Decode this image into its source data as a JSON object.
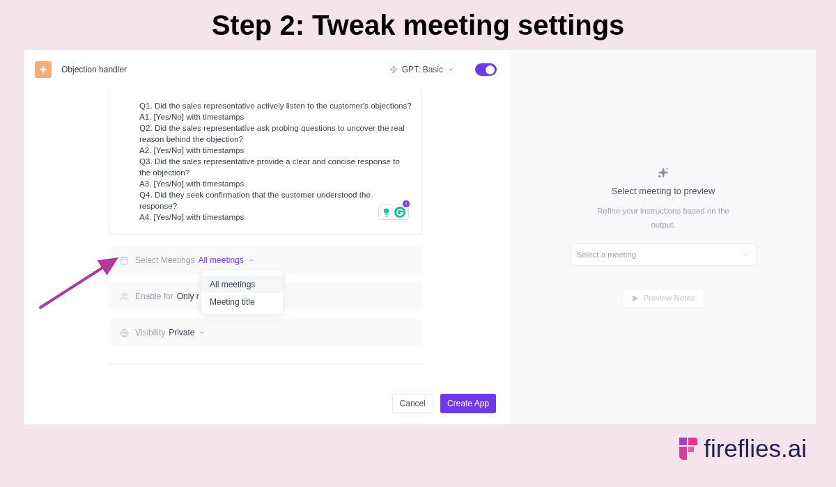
{
  "heading": "Step 2: Tweak meeting settings",
  "app_form": {
    "header": {
      "app_name": "Objection handler",
      "model": "GPT: Basic",
      "enabled": {
        "on": true
      }
    },
    "instruction_lines": [
      "Q1. Did the sales representative actively listen to the customer's objections?",
      "A1. [Yes/No] with timestamps",
      "Q2. Did the sales representative ask probing questions to uncover the real",
      "reason behind the objection?",
      "A2. [Yes/No] with timestamps",
      "Q3. Did the sales representative provide a clear and concise response to",
      "the objection?",
      "A3. [Yes/No] with timestamps",
      "Q4. Did they seek confirmation that the customer understood the",
      "response?",
      "A4. [Yes/No] with timestamps"
    ],
    "writing_assistant": {
      "count": "1"
    },
    "settings": [
      {
        "label": "Select Meetings",
        "value": "All meetings",
        "expanded": true,
        "options": [
          {
            "label": "All meetings",
            "selected": true
          },
          {
            "label": "Meeting title",
            "selected": false
          }
        ]
      },
      {
        "label": "Enable for",
        "value": "Only r"
      },
      {
        "label": "Visibility",
        "value": "Private",
        "expanded": false
      }
    ],
    "buttons": [
      {
        "label": "Cancel",
        "kind": "secondary"
      },
      {
        "label": "Create App",
        "kind": "primary"
      }
    ]
  },
  "preview_panel": {
    "title": "Select meeting to preview",
    "subtitle": "Refine your instructions based on the output.",
    "meeting_select": {
      "placeholder": "Select a meeting"
    },
    "preview_button": {
      "label": "Preview Notes",
      "disabled": true
    }
  },
  "brand": {
    "name": "fireflies.ai"
  }
}
